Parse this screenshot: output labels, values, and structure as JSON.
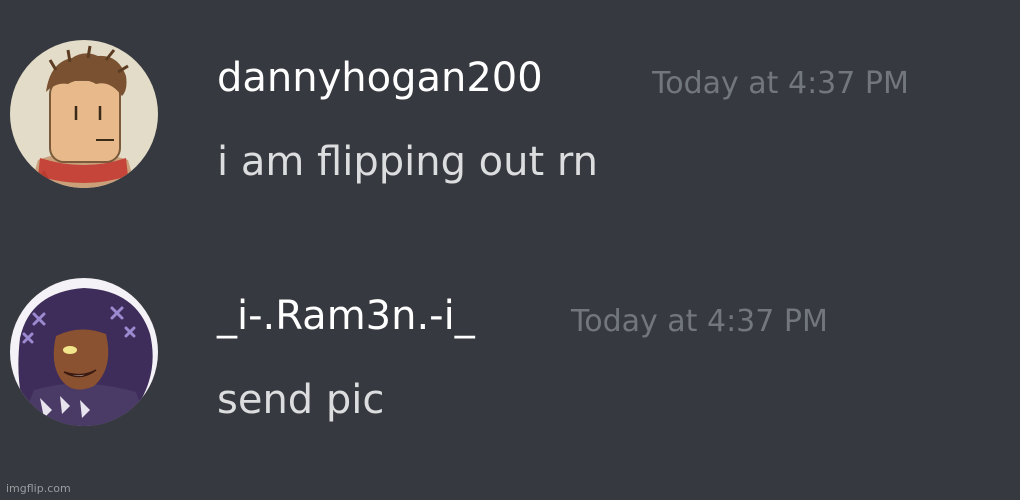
{
  "messages": [
    {
      "username": "dannyhogan200",
      "timestamp": "Today at 4:37 PM",
      "content": "i am flipping out rn",
      "avatar_icon": "hand-drawn-character-avatar"
    },
    {
      "username": "_i-.Ram3n.-i_",
      "timestamp": "Today at 4:37 PM",
      "content": "send pic",
      "avatar_icon": "purple-hair-character-avatar"
    }
  ],
  "watermark": "imgflip.com",
  "colors": {
    "background": "#36393f",
    "username": "#ffffff",
    "message_text": "#dcddde",
    "timestamp": "#72767d"
  }
}
